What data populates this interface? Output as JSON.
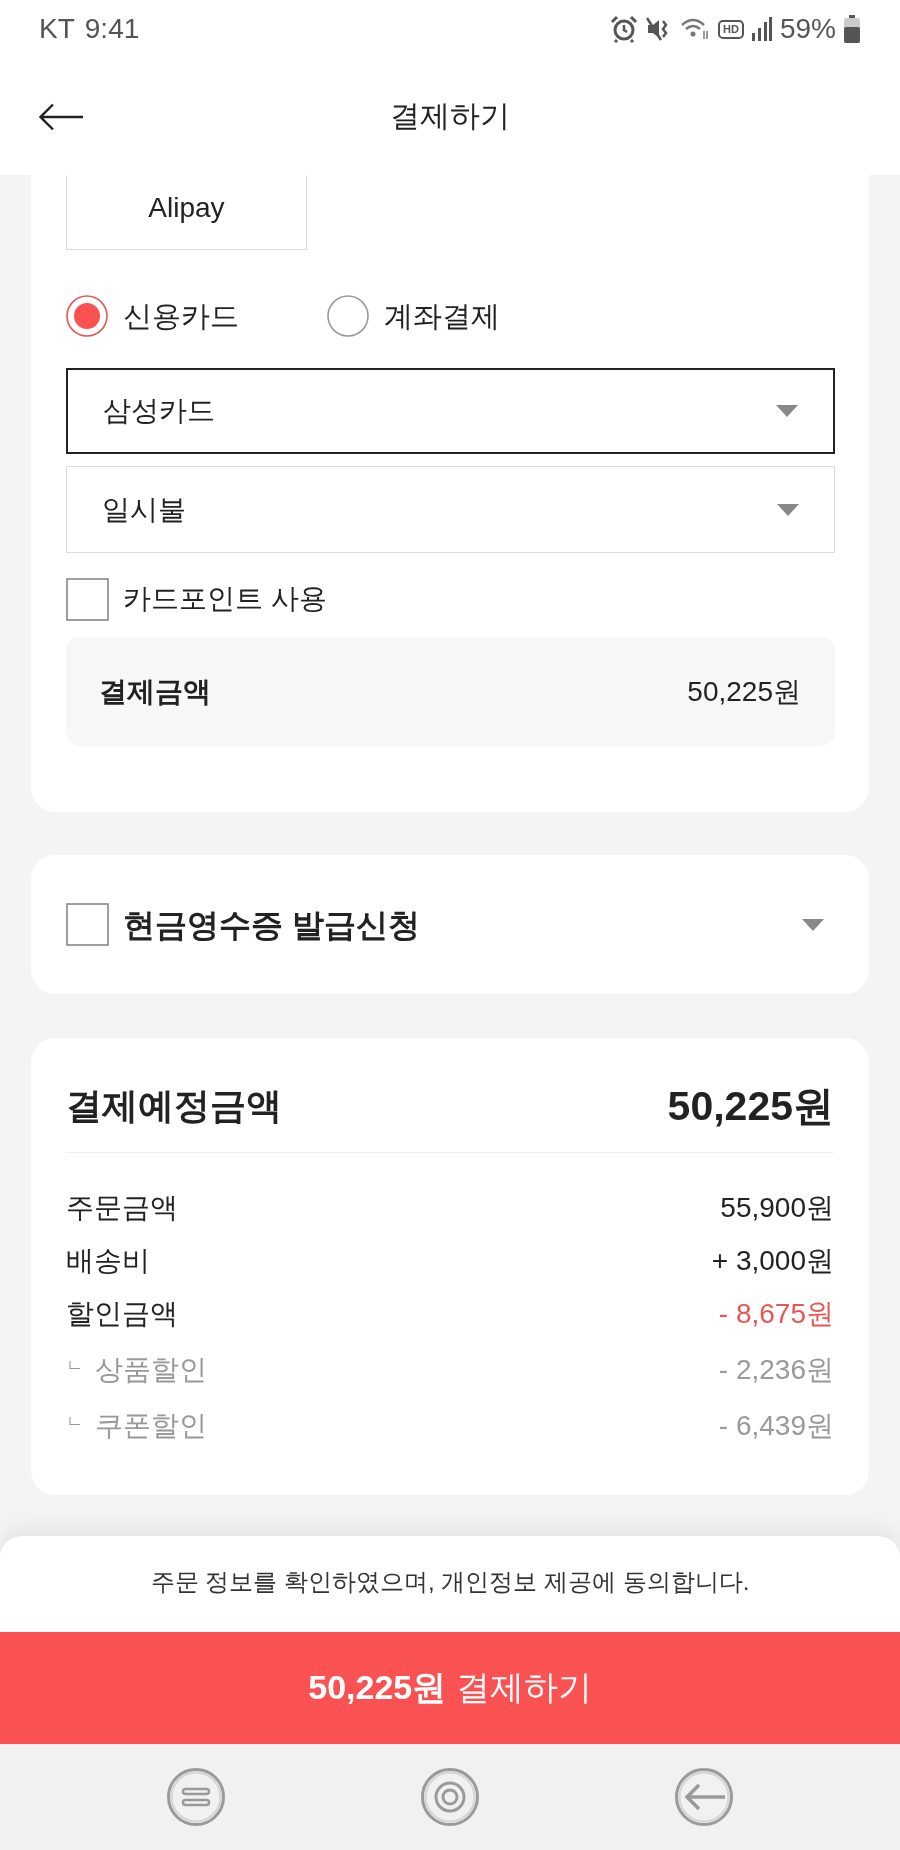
{
  "status_bar": {
    "carrier": "KT",
    "time": "9:41",
    "hd_badge": "HD",
    "battery_percent": "59%"
  },
  "header": {
    "title": "결제하기"
  },
  "payment_method": {
    "easy_pay_option": {
      "label": "Alipay"
    },
    "options": [
      {
        "label": "신용카드",
        "selected": true
      },
      {
        "label": "계좌결제",
        "selected": false
      }
    ],
    "card_select": {
      "value": "삼성카드",
      "active": true
    },
    "installment_select": {
      "value": "일시불",
      "active": false
    },
    "card_point": {
      "label": "카드포인트 사용",
      "checked": false
    },
    "amount": {
      "label": "결제금액",
      "value": "50,225원"
    }
  },
  "cash_receipt": {
    "label": "현금영수증 발급신청",
    "checked": false
  },
  "summary": {
    "title": "결제예정금액",
    "total": "50,225원",
    "rows": [
      {
        "kind": "main",
        "label": "주문금액",
        "value": "55,900원"
      },
      {
        "kind": "main",
        "label": "배송비",
        "value": "+ 3,000원"
      },
      {
        "kind": "discount",
        "label": "할인금액",
        "value": "- 8,675원"
      },
      {
        "kind": "sub",
        "marker": "ㄴ",
        "label": "상품할인",
        "value": "- 2,236원"
      },
      {
        "kind": "sub",
        "marker": "ㄴ",
        "label": "쿠폰할인",
        "value": "- 6,439원"
      }
    ]
  },
  "footer": {
    "agreement": "주문 정보를 확인하였으며, 개인정보 제공에 동의합니다.",
    "pay_button": "**50,225원** 결제하기"
  }
}
